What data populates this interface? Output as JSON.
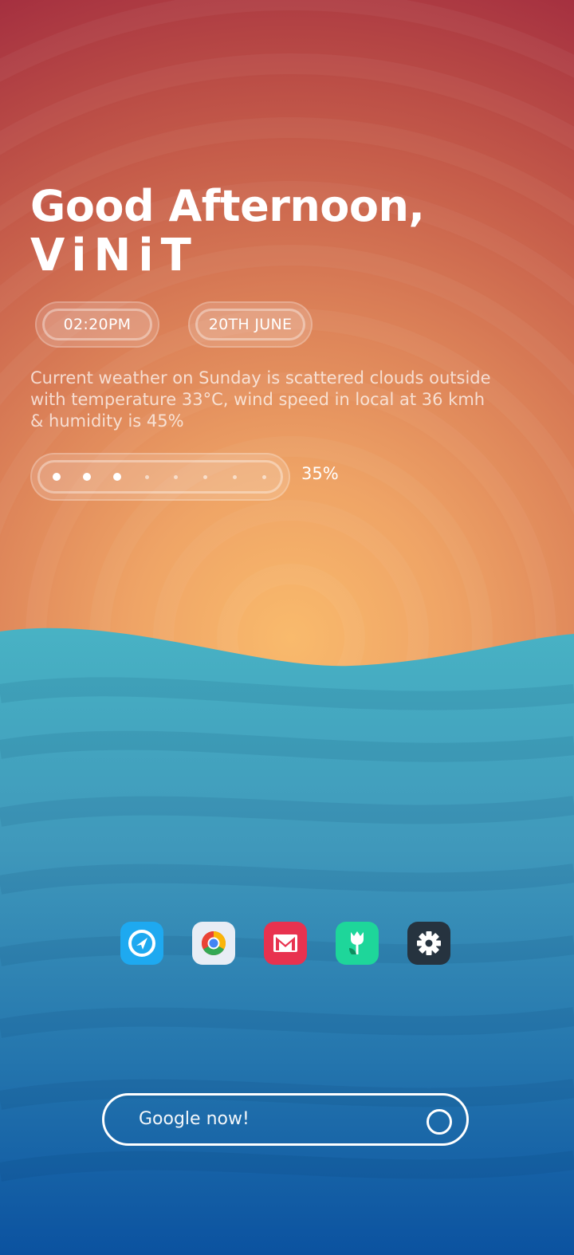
{
  "greeting": {
    "line1": "Good Afternoon,",
    "name": "ViNiT"
  },
  "time": "02:20PM",
  "date": "20TH JUNE",
  "weather_text": "Current weather on Sunday is scattered clouds outside with temperature 33°C, wind speed in local at 36 kmh & humidity is 45%",
  "battery": {
    "percent_label": "35%",
    "level": 0.35,
    "segments_total": 8,
    "segments_on": 3
  },
  "dock": {
    "apps": [
      {
        "name": "telegram-style-navigation",
        "icon": "navigation-arrow-icon",
        "color": "#1ea9f0"
      },
      {
        "name": "chrome",
        "icon": "chrome-icon",
        "color": "#e8edf5"
      },
      {
        "name": "gmail",
        "icon": "gmail-icon",
        "color": "#e8324f"
      },
      {
        "name": "tulip-app",
        "icon": "tulip-icon",
        "color": "#1ed69a"
      },
      {
        "name": "settings",
        "icon": "gear-icon",
        "color": "#26333f"
      }
    ]
  },
  "search": {
    "placeholder": "Google now!"
  },
  "colors": {
    "sky_top": "#a63340",
    "sky_mid": "#e0865a",
    "sun": "#f7b86b",
    "sea_top": "#48b0c2",
    "sea_bottom": "#0b56a3"
  }
}
